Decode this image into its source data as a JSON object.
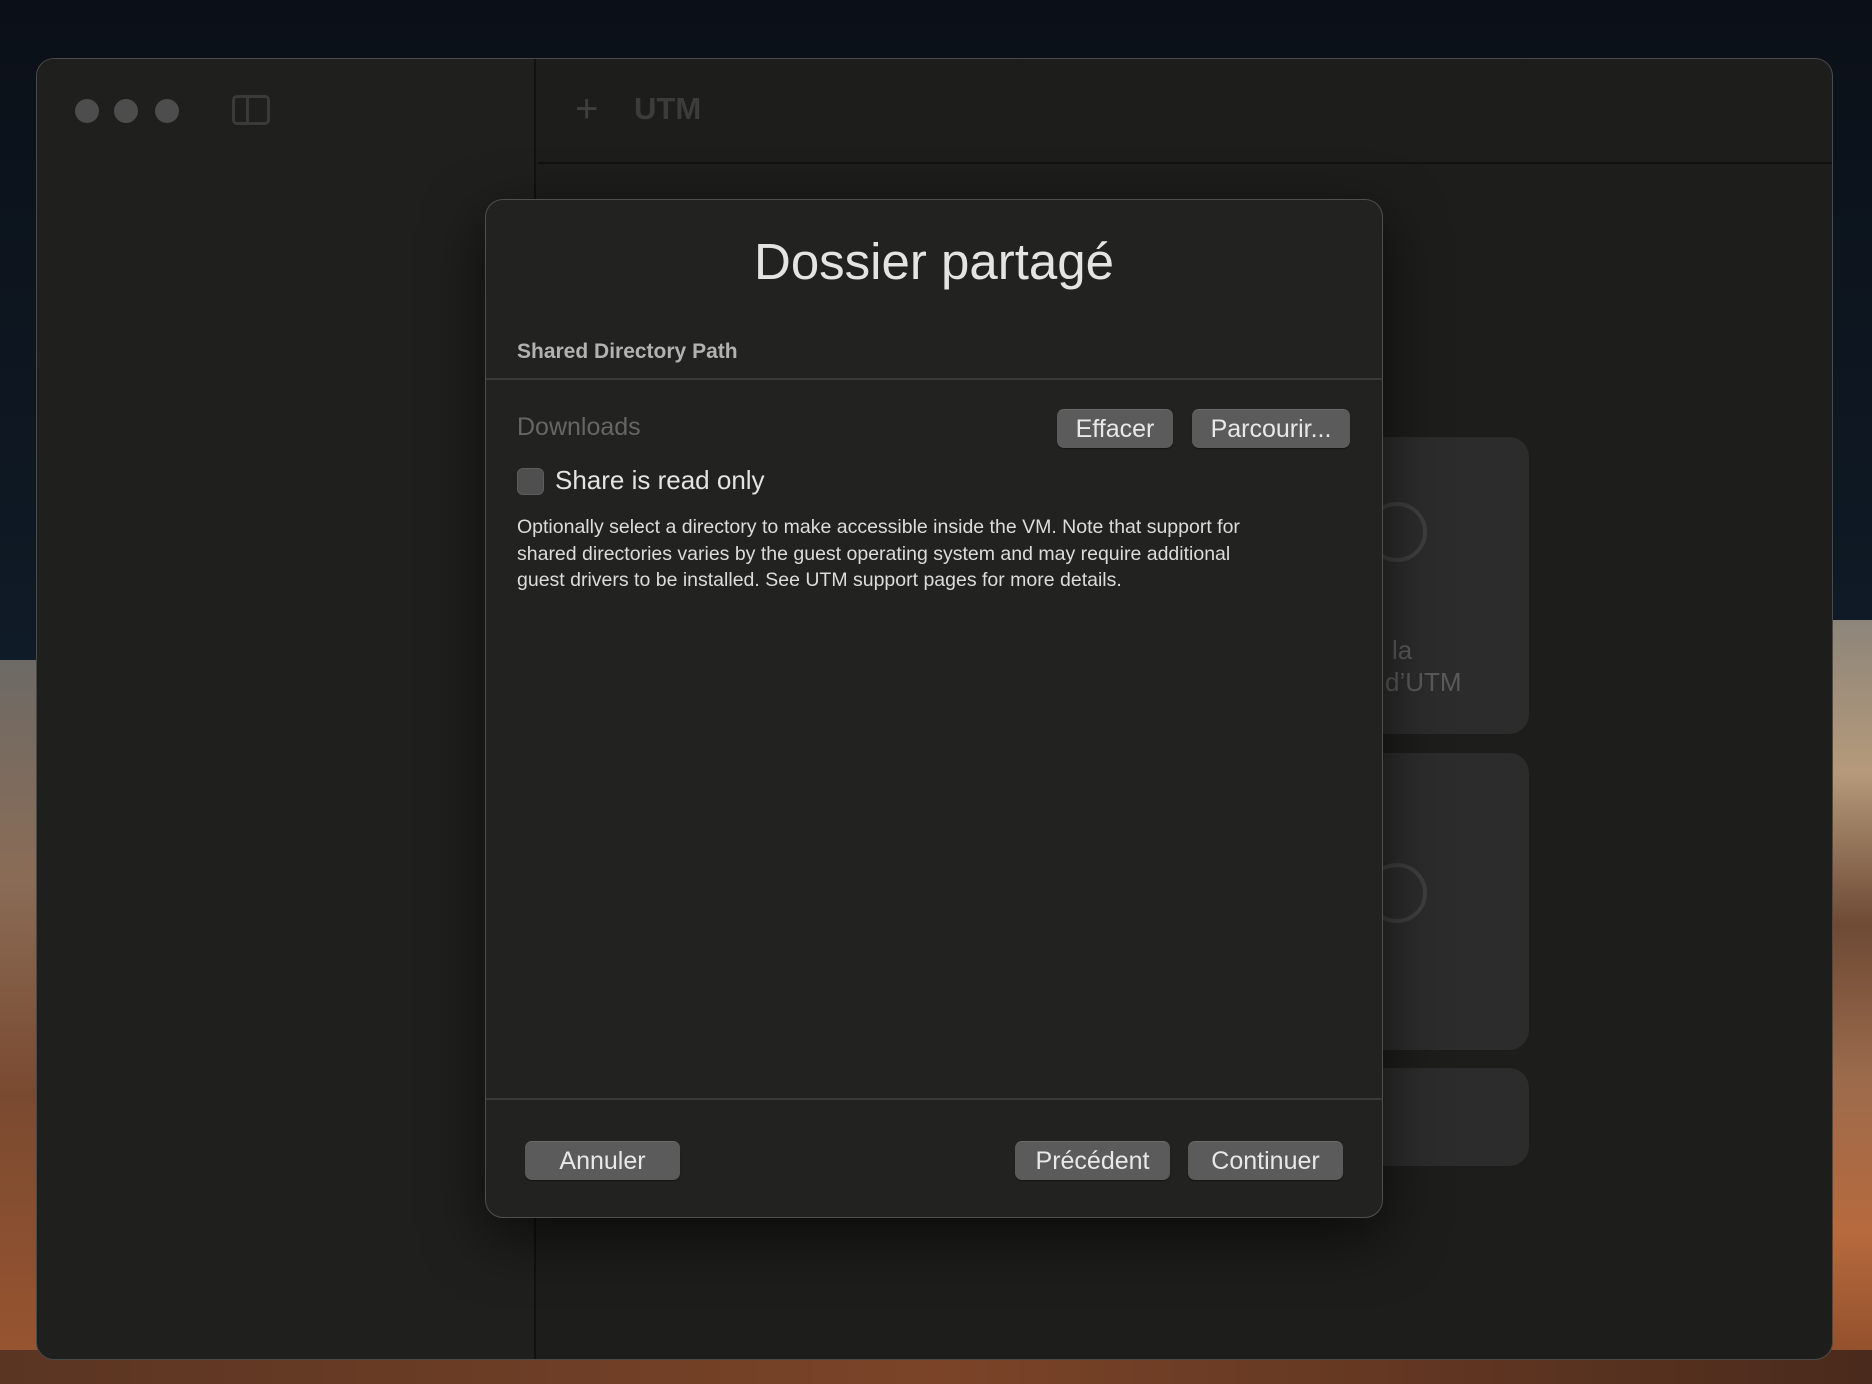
{
  "window": {
    "toolbar": {
      "add_label": "+",
      "title": "UTM"
    }
  },
  "background_cards": [
    {
      "text_line1": "la",
      "text_line2": "d’UTM"
    }
  ],
  "dialog": {
    "title": "Dossier partagé",
    "section_label": "Shared Directory Path",
    "path_value": "Downloads",
    "clear_label": "Effacer",
    "browse_label": "Parcourir...",
    "readonly_label": "Share is read only",
    "readonly_checked": false,
    "description_lines": [
      "Optionally select a directory to make accessible inside the VM. Note that support for",
      "shared directories varies by the guest operating system and may require additional",
      "guest drivers to be installed. See UTM support pages for more details."
    ],
    "cancel_label": "Annuler",
    "previous_label": "Précédent",
    "continue_label": "Continuer"
  }
}
